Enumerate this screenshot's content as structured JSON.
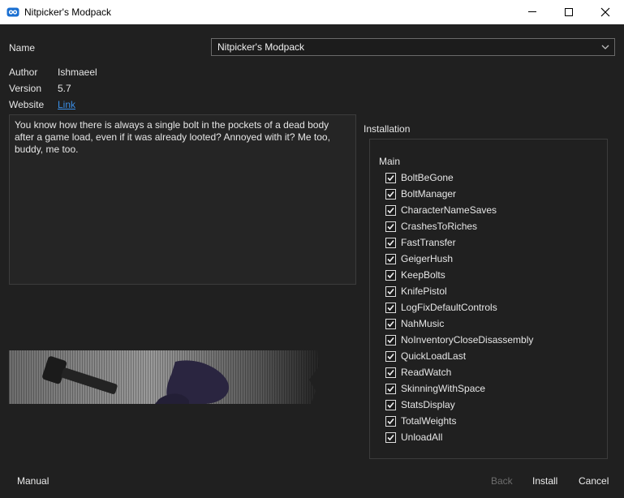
{
  "window": {
    "title": "Nitpicker's Modpack",
    "icon": "app-logo-icon",
    "controls": [
      "minimize-icon",
      "maximize-icon",
      "close-icon"
    ]
  },
  "form": {
    "name_label": "Name",
    "name_value": "Nitpicker's Modpack",
    "author_label": "Author",
    "author_value": "Ishmaeel",
    "version_label": "Version",
    "version_value": "5.7",
    "website_label": "Website",
    "website_link": "Link"
  },
  "description": "You know how there is always a single bolt in the pockets of a dead body after a game load, even if it was already looted? Annoyed with it? Me too, buddy, me too.",
  "installation": {
    "label": "Installation",
    "group": "Main",
    "options": [
      {
        "label": "BoltBeGone",
        "checked": true
      },
      {
        "label": "BoltManager",
        "checked": true
      },
      {
        "label": "CharacterNameSaves",
        "checked": true
      },
      {
        "label": "CrashesToRiches",
        "checked": true
      },
      {
        "label": "FastTransfer",
        "checked": true
      },
      {
        "label": "GeigerHush",
        "checked": true
      },
      {
        "label": "KeepBolts",
        "checked": true
      },
      {
        "label": "KnifePistol",
        "checked": true
      },
      {
        "label": "LogFixDefaultControls",
        "checked": true
      },
      {
        "label": "NahMusic",
        "checked": true
      },
      {
        "label": "NoInventoryCloseDisassembly",
        "checked": true
      },
      {
        "label": "QuickLoadLast",
        "checked": true
      },
      {
        "label": "ReadWatch",
        "checked": true
      },
      {
        "label": "SkinningWithSpace",
        "checked": true
      },
      {
        "label": "StatsDisplay",
        "checked": true
      },
      {
        "label": "TotalWeights",
        "checked": true
      },
      {
        "label": "UnloadAll",
        "checked": true
      }
    ]
  },
  "buttons": {
    "manual": "Manual",
    "back": "Back",
    "install": "Install",
    "cancel": "Cancel"
  },
  "colors": {
    "background": "#202020",
    "link": "#3a8ee6",
    "disabled_text": "#6e6e6e"
  }
}
